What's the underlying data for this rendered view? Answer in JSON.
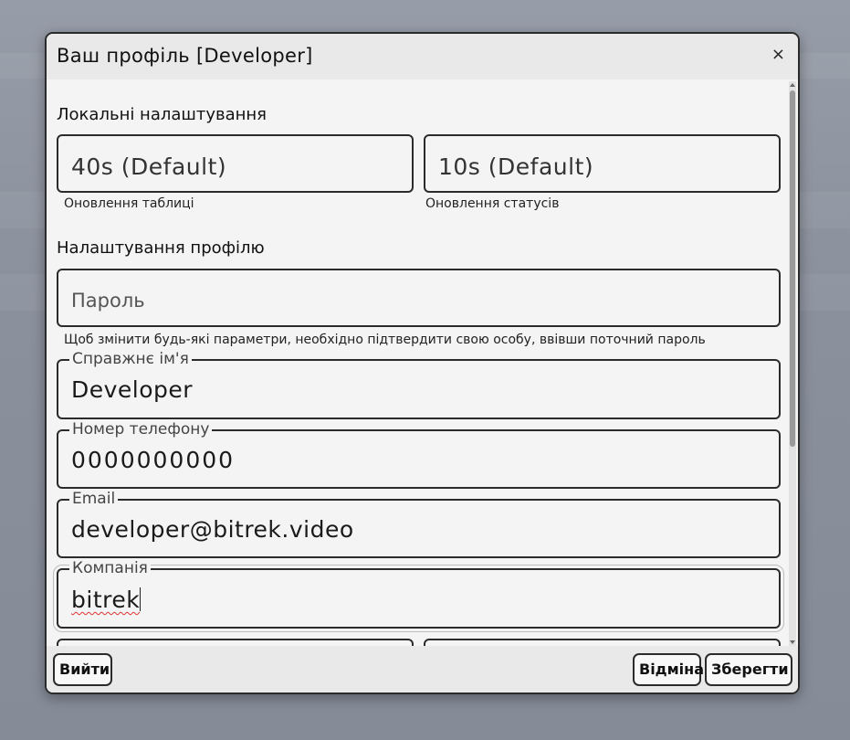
{
  "dialog": {
    "title": "Ваш профіль [Developer]",
    "close_glyph": "×"
  },
  "local_settings": {
    "heading": "Локальні налаштування",
    "table_refresh": {
      "value": "40s (Default)",
      "helper": "Оновлення таблиці"
    },
    "status_refresh": {
      "value": "10s (Default)",
      "helper": "Оновлення статусів"
    }
  },
  "profile_settings": {
    "heading": "Налаштування профілю",
    "password": {
      "placeholder": "Пароль",
      "helper": "Щоб змінити будь-які параметри, необхідно підтвердити свою особу, ввівши поточний пароль"
    },
    "real_name": {
      "label": "Справжнє ім'я",
      "value": "Developer"
    },
    "phone": {
      "label": "Номер телефону",
      "value": "0000000000"
    },
    "email": {
      "label": "Email",
      "value": "developer@bitrek.video"
    },
    "company": {
      "label": "Компанія",
      "value": "bitrek"
    }
  },
  "footer": {
    "logout_label": "Вийти",
    "cancel_label": "Відміна",
    "save_label": "Зберегти"
  },
  "colors": {
    "dialog_bg": "#f4f4f4",
    "header_bg": "#e9e9e9",
    "border": "#2b2b2b",
    "backdrop": "#8c93a0"
  }
}
